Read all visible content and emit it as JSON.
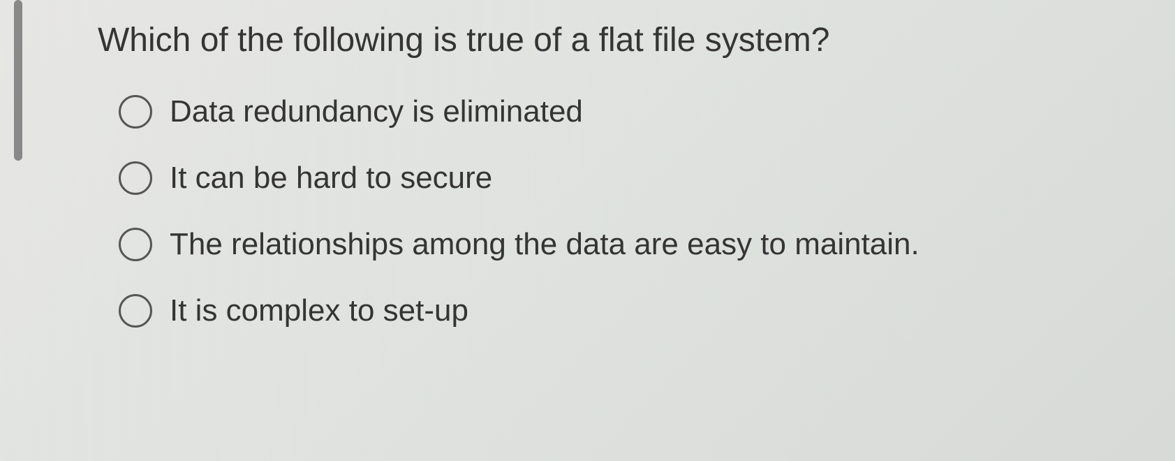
{
  "question": {
    "text": "Which of the following is true of a flat file system?",
    "options": [
      {
        "label": "Data redundancy is eliminated"
      },
      {
        "label": "It can be hard to secure"
      },
      {
        "label": "The relationships among the data are easy to maintain."
      },
      {
        "label": "It is complex to set-up"
      }
    ]
  }
}
